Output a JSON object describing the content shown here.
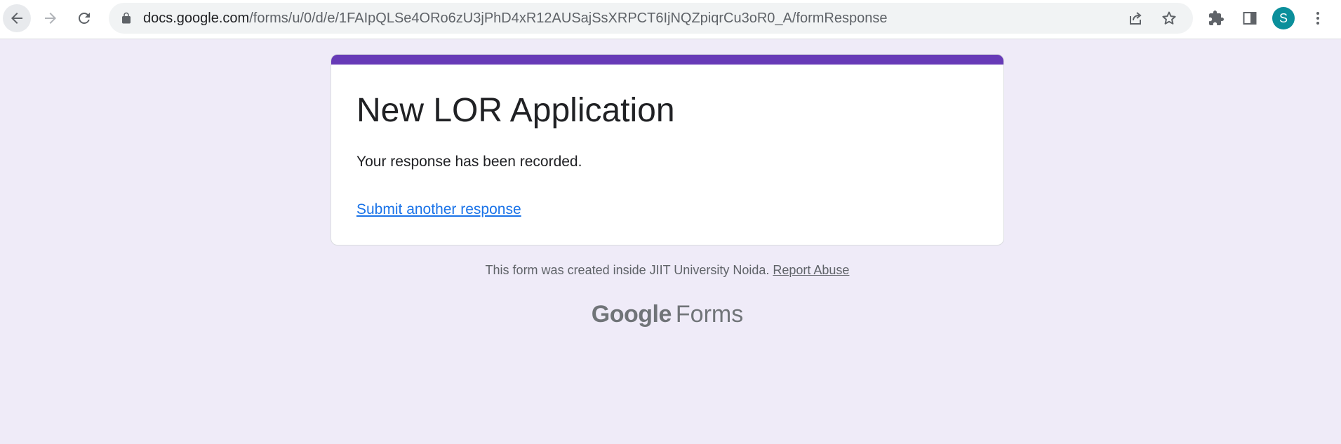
{
  "browser": {
    "url_host": "docs.google.com",
    "url_path": "/forms/u/0/d/e/1FAIpQLSe4ORo6zU3jPhD4xR12AUSajSsXRPCT6IjNQZpiqrCu3oR0_A/formResponse",
    "profile_initial": "S",
    "icons": {
      "back": "arrow-left-icon",
      "forward": "arrow-right-icon",
      "reload": "reload-icon",
      "lock": "lock-icon",
      "share": "share-icon",
      "bookmark": "star-icon",
      "extensions": "puzzle-icon",
      "side_panel": "side-panel-icon",
      "menu": "kebab-menu-icon"
    }
  },
  "form": {
    "title": "New LOR Application",
    "confirmation": "Your response has been recorded.",
    "submit_another": "Submit another response",
    "accent_color": "#673ab7"
  },
  "footer": {
    "note": "This form was created inside JIIT University Noida.",
    "report_abuse": "Report Abuse",
    "brand_google": "Google",
    "brand_forms": "Forms"
  },
  "colors": {
    "page_background": "#efebf8",
    "link": "#1a73e8",
    "avatar": "#0b8f9b"
  }
}
